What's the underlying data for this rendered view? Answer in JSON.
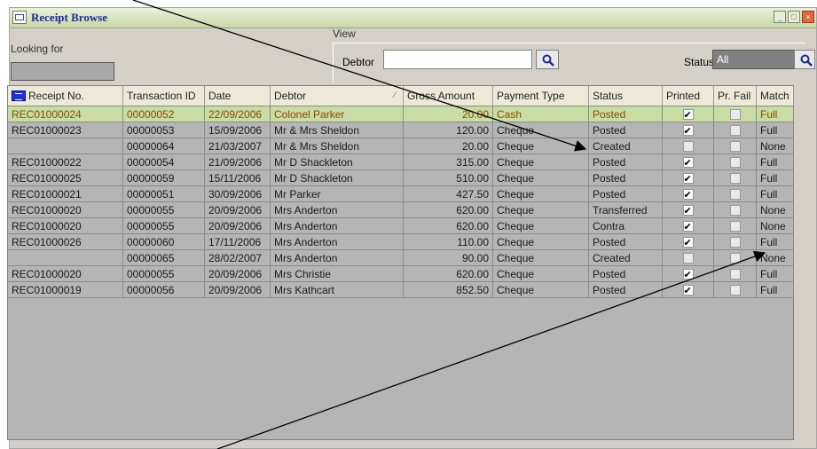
{
  "window": {
    "title": "Receipt Browse",
    "buttons": [
      "_",
      "□",
      "×"
    ]
  },
  "filters": {
    "looking_for_label": "Looking for",
    "view_label": "View",
    "debtor_label": "Debtor",
    "debtor_value": "",
    "status_label": "Status",
    "status_value": "All"
  },
  "table": {
    "columns": [
      "Receipt No.",
      "Transaction ID",
      "Date",
      "Debtor",
      "Gross Amount",
      "Payment Type",
      "Status",
      "Printed",
      "Pr. Fail",
      "Match"
    ],
    "rows": [
      {
        "receipt": "REC01000024",
        "txn": "00000052",
        "date": "22/09/2006",
        "debtor": "Colonel Parker",
        "amount": "20.00",
        "ptype": "Cash",
        "status": "Posted",
        "printed": true,
        "prfail": false,
        "match": "Full",
        "selected": true
      },
      {
        "receipt": "REC01000023",
        "txn": "00000053",
        "date": "15/09/2006",
        "debtor": "Mr & Mrs Sheldon",
        "amount": "120.00",
        "ptype": "Cheque",
        "status": "Posted",
        "printed": true,
        "prfail": false,
        "match": "Full"
      },
      {
        "receipt": "",
        "txn": "00000064",
        "date": "21/03/2007",
        "debtor": "Mr & Mrs Sheldon",
        "amount": "20.00",
        "ptype": "Cheque",
        "status": "Created",
        "printed": false,
        "prfail": false,
        "match": "None"
      },
      {
        "receipt": "REC01000022",
        "txn": "00000054",
        "date": "21/09/2006",
        "debtor": "Mr D Shackleton",
        "amount": "315.00",
        "ptype": "Cheque",
        "status": "Posted",
        "printed": true,
        "prfail": false,
        "match": "Full"
      },
      {
        "receipt": "REC01000025",
        "txn": "00000059",
        "date": "15/11/2006",
        "debtor": "Mr D Shackleton",
        "amount": "510.00",
        "ptype": "Cheque",
        "status": "Posted",
        "printed": true,
        "prfail": false,
        "match": "Full"
      },
      {
        "receipt": "REC01000021",
        "txn": "00000051",
        "date": "30/09/2006",
        "debtor": "Mr Parker",
        "amount": "427.50",
        "ptype": "Cheque",
        "status": "Posted",
        "printed": true,
        "prfail": false,
        "match": "Full"
      },
      {
        "receipt": "REC01000020",
        "txn": "00000055",
        "date": "20/09/2006",
        "debtor": "Mrs Anderton",
        "amount": "620.00",
        "ptype": "Cheque",
        "status": "Transferred",
        "printed": true,
        "prfail": false,
        "match": "None"
      },
      {
        "receipt": "REC01000020",
        "txn": "00000055",
        "date": "20/09/2006",
        "debtor": "Mrs Anderton",
        "amount": "620.00",
        "ptype": "Cheque",
        "status": "Contra",
        "printed": true,
        "prfail": false,
        "match": "None"
      },
      {
        "receipt": "REC01000026",
        "txn": "00000060",
        "date": "17/11/2006",
        "debtor": "Mrs Anderton",
        "amount": "110.00",
        "ptype": "Cheque",
        "status": "Posted",
        "printed": true,
        "prfail": false,
        "match": "Full"
      },
      {
        "receipt": "",
        "txn": "00000065",
        "date": "28/02/2007",
        "debtor": "Mrs Anderton",
        "amount": "90.00",
        "ptype": "Cheque",
        "status": "Created",
        "printed": false,
        "prfail": false,
        "match": "None"
      },
      {
        "receipt": "REC01000020",
        "txn": "00000055",
        "date": "20/09/2006",
        "debtor": "Mrs Christie",
        "amount": "620.00",
        "ptype": "Cheque",
        "status": "Posted",
        "printed": true,
        "prfail": false,
        "match": "Full"
      },
      {
        "receipt": "REC01000019",
        "txn": "00000056",
        "date": "20/09/2006",
        "debtor": "Mrs Kathcart",
        "amount": "852.50",
        "ptype": "Cheque",
        "status": "Posted",
        "printed": true,
        "prfail": false,
        "match": "Full"
      }
    ]
  },
  "colors": {
    "selected_row": "#c8dca3",
    "selected_text": "#8b4a00",
    "grid_bg": "#b5b5b5"
  }
}
